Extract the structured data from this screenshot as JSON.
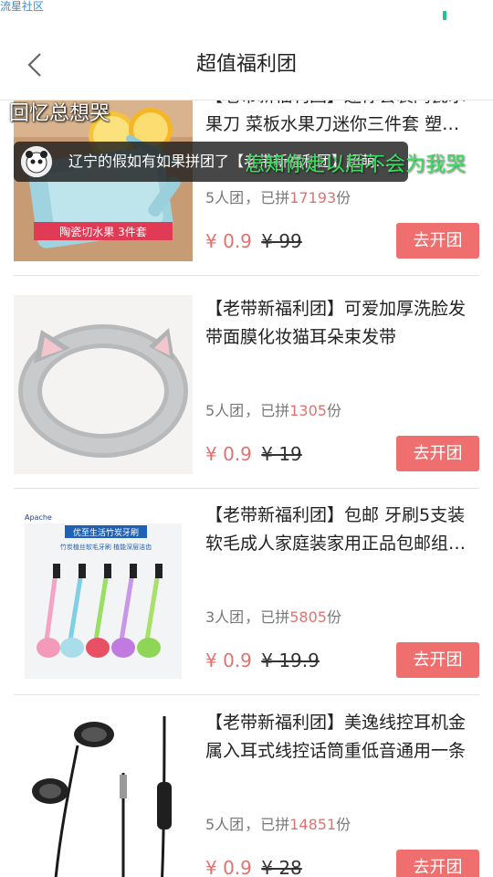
{
  "status": {
    "carrier": "流星社区"
  },
  "header": {
    "title": "超值福利团"
  },
  "overlay": {
    "top_text": "回忆总想哭",
    "toast_text": "辽宁的假如有如果拼团了【老带新福利团】超萌…",
    "danmaku": "怎知你走以后不会为我哭"
  },
  "products": [
    {
      "title": "【老带新福利团】迷你套装陶瓷水果刀 菜板水果刀迷你三件套 塑…",
      "group_size": "5人团",
      "joined_label": "已拼",
      "joined_count": "17193",
      "unit": "份",
      "price": "¥ 0.9",
      "original_price": "¥ 99",
      "button": "去开团",
      "image_label": "陶瓷切水果 3件套",
      "image_icon": "ceramic-knife-set-image"
    },
    {
      "title": "【老带新福利团】可爱加厚洗脸发带面膜化妆猫耳朵束发带",
      "group_size": "5人团",
      "joined_label": "已拼",
      "joined_count": "1305",
      "unit": "份",
      "price": "¥ 0.9",
      "original_price": "¥ 19",
      "button": "去开团",
      "image_icon": "cat-ear-headband-image"
    },
    {
      "title": "【老带新福利团】包邮 牙刷5支装软毛成人家庭装家用正品包邮组…",
      "group_size": "3人团",
      "joined_label": "已拼",
      "joined_count": "5805",
      "unit": "份",
      "price": "¥ 0.9",
      "original_price": "¥ 19.9",
      "button": "去开团",
      "image_brand": "Apache",
      "image_label": "优至生活竹炭牙刷",
      "image_caption": "竹炭植丝软毛牙刷 植能深层洁齿",
      "image_icon": "toothbrush-set-image"
    },
    {
      "title": "【老带新福利团】美逸线控耳机金属入耳式线控话筒重低音通用一条",
      "group_size": "5人团",
      "joined_label": "已拼",
      "joined_count": "14851",
      "unit": "份",
      "price": "¥ 0.9",
      "original_price": "¥ 28",
      "button": "去开团",
      "image_icon": "earphones-image"
    }
  ],
  "colors": {
    "accent": "#ef6f6f",
    "price": "#e2726f",
    "danmaku": "#39e05e"
  }
}
